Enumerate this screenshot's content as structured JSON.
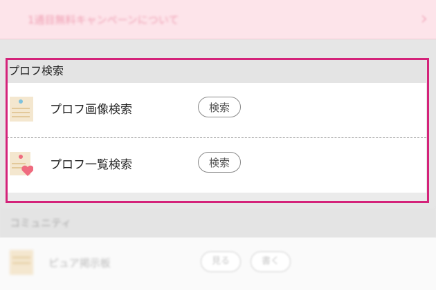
{
  "top_banner": {
    "text": "1通目無料キャンペーンについて",
    "arrow": "›"
  },
  "profile_search": {
    "header": "プロフ検索",
    "rows": [
      {
        "label": "プロフ画像検索",
        "button": "検索",
        "icon": "profile-card-icon"
      },
      {
        "label": "プロフ一覧検索",
        "button": "検索",
        "icon": "profile-list-heart-icon"
      }
    ]
  },
  "community": {
    "header": "コミュニティ",
    "row_label": "ピュア掲示板",
    "buttons": [
      "見る",
      "書く"
    ]
  },
  "colors": {
    "highlight_border": "#d4237a",
    "banner_bg": "#fde4ea",
    "icon_pink": "#ef6b7f",
    "icon_blue": "#7fc2dd",
    "icon_beige": "#f4e7cf"
  }
}
